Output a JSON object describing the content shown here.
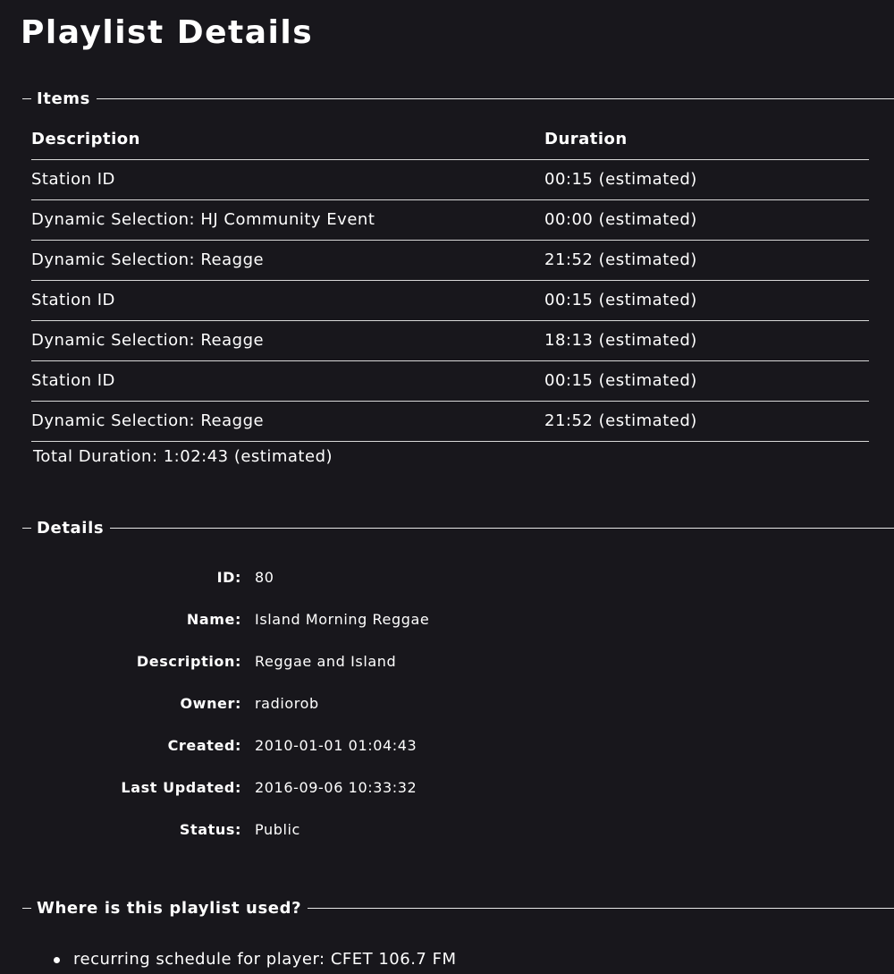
{
  "page": {
    "title": "Playlist Details"
  },
  "items_section": {
    "legend": "Items",
    "columns": {
      "description": "Description",
      "duration": "Duration"
    },
    "rows": [
      {
        "description": "Station ID",
        "duration": "00:15 (estimated)"
      },
      {
        "description": "Dynamic Selection: HJ Community Event",
        "duration": "00:00 (estimated)"
      },
      {
        "description": "Dynamic Selection: Reagge",
        "duration": "21:52 (estimated)"
      },
      {
        "description": "Station ID",
        "duration": "00:15 (estimated)"
      },
      {
        "description": "Dynamic Selection: Reagge",
        "duration": "18:13 (estimated)"
      },
      {
        "description": "Station ID",
        "duration": "00:15 (estimated)"
      },
      {
        "description": "Dynamic Selection: Reagge",
        "duration": "21:52 (estimated)"
      }
    ],
    "total": "Total Duration: 1:02:43 (estimated)"
  },
  "details_section": {
    "legend": "Details",
    "fields": [
      {
        "label": "ID:",
        "value": "80"
      },
      {
        "label": "Name:",
        "value": "Island Morning Reggae"
      },
      {
        "label": "Description:",
        "value": "Reggae and Island"
      },
      {
        "label": "Owner:",
        "value": "radiorob"
      },
      {
        "label": "Created:",
        "value": "2010-01-01 01:04:43"
      },
      {
        "label": "Last Updated:",
        "value": "2016-09-06 10:33:32"
      },
      {
        "label": "Status:",
        "value": "Public"
      }
    ]
  },
  "usage_section": {
    "legend": "Where is this playlist used?",
    "items": [
      "recurring schedule for player: CFET 106.7 FM"
    ]
  },
  "colors": {
    "background": "#18171c",
    "text": "#ffffff",
    "rule": "#e8e8e8"
  }
}
